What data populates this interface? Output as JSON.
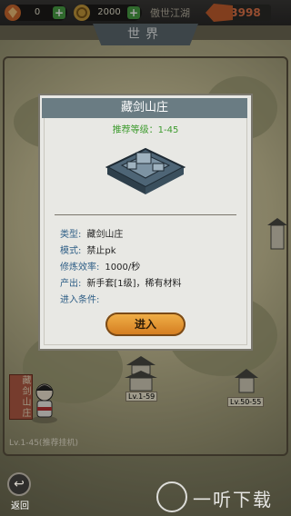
{
  "topbar": {
    "resource1": {
      "value": "0",
      "icon": "gem-icon",
      "plus": "+"
    },
    "resource2": {
      "value": "2000",
      "icon": "coin-icon",
      "plus": "+"
    },
    "server_name": "傲世江湖",
    "vip_value": "3998"
  },
  "world_banner": "世界",
  "popup": {
    "title": "藏剑山庄",
    "recommend": "推荐等级：1-45",
    "rows": [
      {
        "key": "类型:",
        "value": "藏剑山庄"
      },
      {
        "key": "模式:",
        "value": "禁止pk"
      },
      {
        "key": "修炼效率:",
        "value": "1000/秒"
      },
      {
        "key": "产出:",
        "value": "新手套[1级]，稀有材料"
      },
      {
        "key": "进入条件:",
        "value": ""
      }
    ],
    "enter_button": "进入"
  },
  "map": {
    "level_labels": [
      "Lv.1-59",
      "Lv.50-55"
    ],
    "player_level": "Lv.1-45(推荐挂机)",
    "side_tag": "藏剑山庄"
  },
  "back_label": "返回",
  "watermark": "一听下载",
  "colors": {
    "accent": "#3d9b2e",
    "title_bg": "#6a7c83",
    "button": "#e69a34"
  }
}
